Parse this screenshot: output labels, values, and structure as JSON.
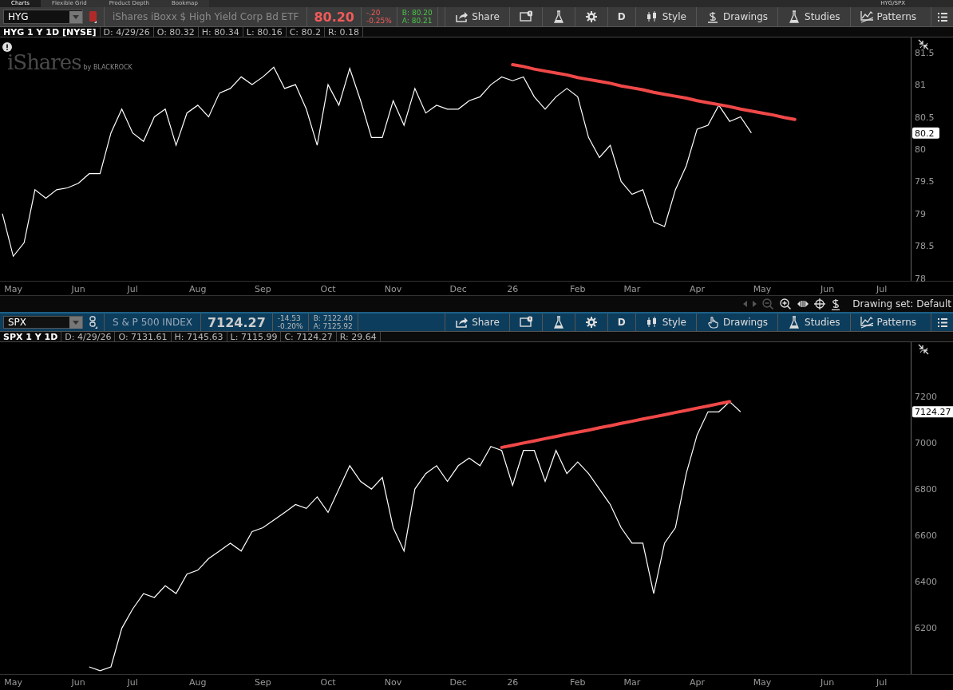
{
  "top_tabs": [
    {
      "label": "Charts",
      "selected": true
    },
    {
      "label": "Flexible Grid",
      "selected": false
    },
    {
      "label": "Product Depth",
      "selected": false
    },
    {
      "label": "Bookmap",
      "selected": false
    }
  ],
  "layout_name": "HYG/SPX",
  "panels": [
    {
      "toolbar": {
        "active": false,
        "symbol": "HYG",
        "description": "iShares iBoxx $ High Yield Corp Bd ETF",
        "price": "80.20",
        "down": true,
        "change": "-.20",
        "change_pct": "-0.25%",
        "bid": "B: 80.20",
        "ask": "A: 80.21",
        "quote_up": true,
        "link": {
          "kind": "swatch",
          "color": "#b02a2a"
        },
        "buttons": [
          {
            "kind": "share",
            "label": "Share"
          },
          {
            "kind": "alert"
          },
          {
            "kind": "flask"
          },
          {
            "kind": "gear"
          },
          {
            "kind": "text",
            "label": "D"
          },
          {
            "kind": "style",
            "label": "Style"
          },
          {
            "kind": "drawings-dollar",
            "label": "Drawings"
          },
          {
            "kind": "studies",
            "label": "Studies"
          },
          {
            "kind": "patterns",
            "label": "Patterns"
          }
        ]
      },
      "info": {
        "title": "HYG 1 Y 1D [NYSE]",
        "fields": [
          "D: 4/29/26",
          "O: 80.32",
          "H: 80.34",
          "L: 80.16",
          "C: 80.2",
          "R: 0.18"
        ]
      },
      "logo": {
        "brand": "iShares",
        "by": "by BLACKROCK"
      },
      "price_tag": "80.2",
      "chart_data": {
        "type": "line",
        "ylim": [
          77.96,
          81.73
        ],
        "categories": [
          null,
          "May",
          null,
          null,
          null,
          null,
          null,
          "Jun",
          null,
          null,
          null,
          null,
          "Jul",
          null,
          null,
          null,
          null,
          null,
          "Aug",
          null,
          null,
          null,
          null,
          null,
          "Sep",
          null,
          null,
          null,
          null,
          null,
          "Oct",
          null,
          null,
          null,
          null,
          null,
          "Nov",
          null,
          null,
          null,
          null,
          null,
          "Dec",
          null,
          null,
          null,
          null,
          "26",
          null,
          null,
          null,
          null,
          null,
          "Feb",
          null,
          null,
          null,
          null,
          "Mar",
          null,
          null,
          null,
          null,
          null,
          "Apr",
          null,
          null,
          null,
          null,
          null,
          "May",
          null,
          null,
          null,
          null,
          null,
          "Jun",
          null,
          null,
          null,
          null,
          "Jul",
          null,
          null,
          null
        ],
        "yticks": [
          78,
          78.5,
          79,
          79.5,
          80,
          80.5,
          81,
          81.5
        ],
        "series": [
          {
            "color": "#ffffff",
            "values": [
              79.0,
              78.34,
              78.55,
              79.37,
              79.24,
              79.37,
              79.4,
              79.47,
              79.62,
              79.62,
              80.25,
              80.62,
              80.25,
              80.12,
              80.5,
              80.62,
              80.06,
              80.56,
              80.68,
              80.5,
              80.87,
              80.94,
              81.12,
              81.0,
              81.12,
              81.27,
              80.94,
              81.0,
              80.62,
              80.06,
              81.0,
              80.68,
              81.25,
              80.75,
              80.18,
              80.18,
              80.75,
              80.37,
              80.94,
              80.56,
              80.68,
              80.62,
              80.62,
              80.75,
              80.81,
              81.0,
              81.12,
              81.06,
              81.12,
              80.81,
              80.62,
              80.81,
              80.94,
              80.81,
              80.18,
              79.87,
              80.06,
              79.5,
              79.3,
              79.37,
              78.87,
              78.8,
              79.37,
              79.74,
              80.31,
              80.37,
              80.68,
              80.43,
              80.5,
              80.25,
              null,
              null,
              null,
              null,
              null,
              null,
              null,
              null,
              null,
              null,
              null,
              null,
              null,
              null,
              null
            ]
          },
          {
            "color": "#f04848",
            "values": [
              null,
              null,
              null,
              null,
              null,
              null,
              null,
              null,
              null,
              null,
              null,
              null,
              null,
              null,
              null,
              null,
              null,
              null,
              null,
              null,
              null,
              null,
              null,
              null,
              null,
              null,
              null,
              null,
              null,
              null,
              null,
              null,
              null,
              null,
              null,
              null,
              null,
              null,
              null,
              null,
              null,
              null,
              null,
              null,
              null,
              null,
              null,
              81.31,
              81.28,
              81.24,
              81.21,
              81.18,
              81.15,
              81.11,
              81.08,
              81.05,
              81.02,
              80.98,
              80.95,
              80.92,
              80.88,
              80.85,
              80.82,
              80.79,
              80.75,
              80.72,
              80.69,
              80.66,
              80.62,
              80.59,
              80.56,
              80.53,
              80.49,
              80.46,
              null,
              null,
              null,
              null,
              null,
              null,
              null,
              null,
              null,
              null,
              null
            ]
          }
        ]
      }
    },
    {
      "toolbar": {
        "active": true,
        "symbol": "SPX",
        "description": "S & P 500 INDEX",
        "price": "7124.27",
        "down": false,
        "change": "-14.53",
        "change_pct": "-0.20%",
        "bid": "B: 7122.40",
        "ask": "A: 7125.92",
        "quote_up": false,
        "link": {
          "kind": "chain"
        },
        "buttons": [
          {
            "kind": "share",
            "label": "Share"
          },
          {
            "kind": "alert"
          },
          {
            "kind": "flask"
          },
          {
            "kind": "gear"
          },
          {
            "kind": "text",
            "label": "D"
          },
          {
            "kind": "style",
            "label": "Style"
          },
          {
            "kind": "drawings-hand",
            "label": "Drawings"
          },
          {
            "kind": "studies",
            "label": "Studies"
          },
          {
            "kind": "patterns",
            "label": "Patterns"
          }
        ]
      },
      "info": {
        "title": "SPX 1 Y 1D",
        "fields": [
          "D: 4/29/26",
          "O: 7131.61",
          "H: 7145.63",
          "L: 7115.99",
          "C: 7124.27",
          "R: 29.64"
        ]
      },
      "price_tag": "7124.27",
      "chart_data": {
        "type": "line",
        "ylim": [
          5999,
          7434
        ],
        "categories": [
          null,
          "May",
          null,
          null,
          null,
          null,
          null,
          "Jun",
          null,
          null,
          null,
          null,
          "Jul",
          null,
          null,
          null,
          null,
          null,
          "Aug",
          null,
          null,
          null,
          null,
          null,
          "Sep",
          null,
          null,
          null,
          null,
          null,
          "Oct",
          null,
          null,
          null,
          null,
          null,
          "Nov",
          null,
          null,
          null,
          null,
          null,
          "Dec",
          null,
          null,
          null,
          null,
          "26",
          null,
          null,
          null,
          null,
          null,
          "Feb",
          null,
          null,
          null,
          null,
          "Mar",
          null,
          null,
          null,
          null,
          null,
          "Apr",
          null,
          null,
          null,
          null,
          null,
          "May",
          null,
          null,
          null,
          null,
          null,
          "Jun",
          null,
          null,
          null,
          null,
          "Jul",
          null,
          null,
          null
        ],
        "yticks": [
          6200,
          6400,
          6600,
          6800,
          7000,
          7200
        ],
        "series": [
          {
            "color": "#ffffff",
            "values": [
              null,
              null,
              null,
              null,
              null,
              null,
              null,
              null,
              6030,
              6013,
              6030,
              6197,
              6280,
              6347,
              6330,
              6381,
              6347,
              6431,
              6448,
              6498,
              6531,
              6565,
              6531,
              6615,
              6632,
              6665,
              6698,
              6732,
              6715,
              6765,
              6698,
              6799,
              6900,
              6832,
              6799,
              6849,
              6632,
              6531,
              6799,
              6866,
              6900,
              6832,
              6900,
              6933,
              6900,
              6983,
              6966,
              6815,
              6966,
              6966,
              6832,
              6966,
              6866,
              6916,
              6866,
              6799,
              6732,
              6632,
              6565,
              6565,
              6347,
              6565,
              6632,
              6866,
              7033,
              7133,
              7133,
              7177,
              7133,
              null,
              null,
              null,
              null,
              null,
              null,
              null,
              null,
              null,
              null,
              null,
              null,
              null,
              null,
              null,
              null
            ]
          },
          {
            "color": "#f04848",
            "values": [
              null,
              null,
              null,
              null,
              null,
              null,
              null,
              null,
              null,
              null,
              null,
              null,
              null,
              null,
              null,
              null,
              null,
              null,
              null,
              null,
              null,
              null,
              null,
              null,
              null,
              null,
              null,
              null,
              null,
              null,
              null,
              null,
              null,
              null,
              null,
              null,
              null,
              null,
              null,
              null,
              null,
              null,
              null,
              null,
              null,
              null,
              6979,
              6988,
              6998,
              7007,
              7017,
              7026,
              7036,
              7045,
              7054,
              7064,
              7073,
              7083,
              7092,
              7102,
              7111,
              7120,
              7130,
              7139,
              7149,
              7158,
              7168,
              7177,
              null,
              null,
              null,
              null,
              null,
              null,
              null,
              null,
              null,
              null,
              null,
              null,
              null,
              null,
              null,
              null,
              null
            ]
          }
        ]
      }
    }
  ],
  "nav_bar": {
    "drawing_set": "Drawing set: Default"
  }
}
